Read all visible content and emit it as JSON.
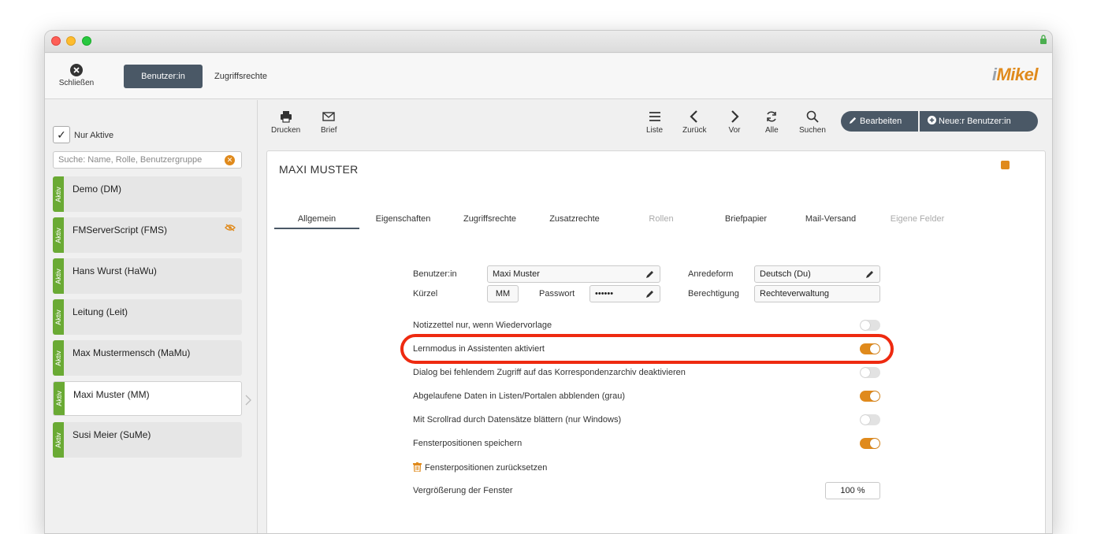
{
  "window": {
    "accent": "#4a5866",
    "highlight": "#e08a1c"
  },
  "toolbar": {
    "close_label": "Schließen",
    "tab_user": "Benutzer:in",
    "tab_rights": "Zugriffsrechte",
    "logo_prefix": "i",
    "logo_text": "Mikel"
  },
  "sidebar": {
    "filter_label": "Nur Aktive",
    "filter_checked": true,
    "search_placeholder": "Suche: Name, Rolle, Benutzergruppe",
    "status_label": "Aktiv",
    "users": [
      {
        "name": "Demo (DM)"
      },
      {
        "name": "FMServerScript (FMS)"
      },
      {
        "name": "Hans Wurst (HaWu)"
      },
      {
        "name": "Leitung (Leit)"
      },
      {
        "name": "Max Mustermensch (MaMu)"
      },
      {
        "name": "Maxi Muster (MM)"
      },
      {
        "name": "Susi Meier (SuMe)"
      }
    ]
  },
  "actions": {
    "print": "Drucken",
    "letter": "Brief",
    "list": "Liste",
    "back": "Zurück",
    "forward": "Vor",
    "all": "Alle",
    "search": "Suchen",
    "edit": "Bearbeiten",
    "new_user": "Neue:r Benutzer:in"
  },
  "record": {
    "title": "MAXI MUSTER",
    "tabs": [
      "Allgemein",
      "Eigenschaften",
      "Zugriffsrechte",
      "Zusatzrechte",
      "Rollen",
      "Briefpapier",
      "Mail-Versand",
      "Eigene Felder"
    ],
    "fields": {
      "user_label": "Benutzer:in",
      "user_value": "Maxi Muster",
      "salutation_label": "Anredeform",
      "salutation_value": "Deutsch (Du)",
      "short_label": "Kürzel",
      "short_value": "MM",
      "password_label": "Passwort",
      "password_value": "••••••",
      "permission_label": "Berechtigung",
      "permission_value": "Rechteverwaltung"
    },
    "options": [
      {
        "label": "Notizzettel nur, wenn Wiedervorlage",
        "on": false
      },
      {
        "label": "Lernmodus in Assistenten aktiviert",
        "on": true
      },
      {
        "label": "Dialog bei fehlendem Zugriff auf das Korrespondenzarchiv deaktivieren",
        "on": false
      },
      {
        "label": "Abgelaufene Daten in Listen/Portalen abblenden (grau)",
        "on": true
      },
      {
        "label": "Mit Scrollrad durch Datensätze blättern (nur Windows)",
        "on": false
      },
      {
        "label": "Fensterpositionen speichern",
        "on": true
      }
    ],
    "reset_label": "Fensterpositionen zurücksetzen",
    "zoom_label": "Vergrößerung der Fenster",
    "zoom_value": "100 %"
  }
}
